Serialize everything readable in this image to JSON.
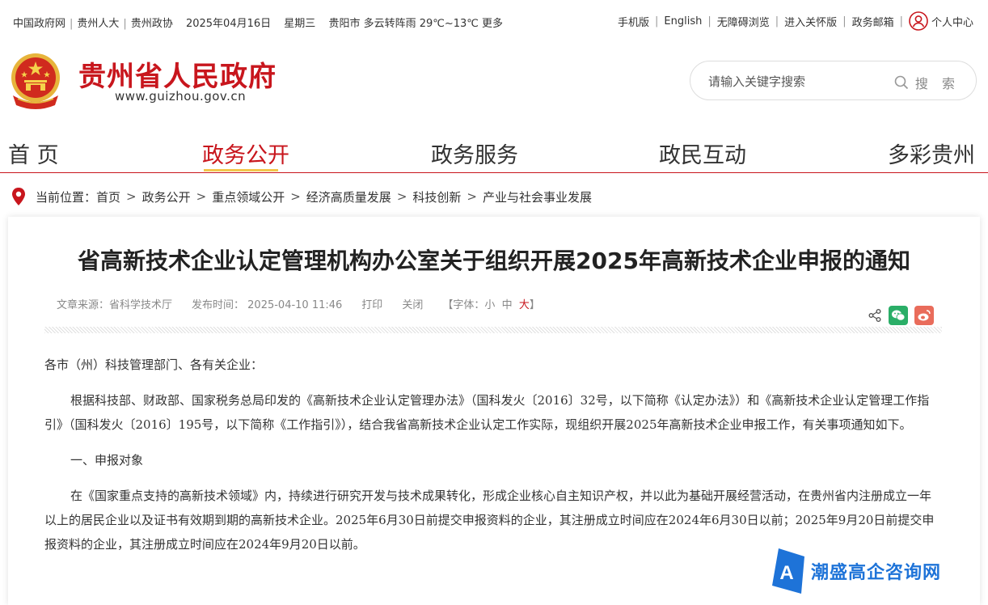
{
  "topbar": {
    "left_links": [
      "中国政府网",
      "贵州人大",
      "贵州政协"
    ],
    "date": "2025年04月16日",
    "weekday": "星期三",
    "weather": "贵阳市 多云转阵雨 29℃~13℃",
    "more": "更多",
    "right_links": [
      "手机版",
      "English",
      "无障碍浏览",
      "进入关怀版",
      "政务邮箱"
    ],
    "user_center": "个人中心"
  },
  "header": {
    "site_title": "贵州省人民政府",
    "site_url": "www.guizhou.gov.cn",
    "search_placeholder": "请输入关键字搜索",
    "search_button": "搜 索"
  },
  "nav": {
    "items": [
      "首 页",
      "政务公开",
      "政务服务",
      "政民互动",
      "多彩贵州"
    ],
    "active": "政务公开"
  },
  "breadcrumb": {
    "label": "当前位置：",
    "items": [
      "首页",
      "政务公开",
      "重点领域公开",
      "经济高质量发展",
      "科技创新",
      "产业与社会事业发展"
    ]
  },
  "article": {
    "title": "省高新技术企业认定管理机构办公室关于组织开展2025年高新技术企业申报的通知",
    "source": "文章来源：省科学技术厅",
    "publish_time": "发布时间：  2025-04-10 11:46",
    "print": "打印",
    "close": "关闭",
    "font_size_label": "【字体：",
    "font_small": "小",
    "font_medium": "中",
    "font_large": "大",
    "font_close": "】",
    "paragraphs": [
      "各市（州）科技管理部门、各有关企业：",
      "根据科技部、财政部、国家税务总局印发的《高新技术企业认定管理办法》（国科发火〔2016〕32号，以下简称《认定办法》）和《高新技术企业认定管理工作指引》（国科发火〔2016〕195号，以下简称《工作指引》），结合我省高新技术企业认定工作实际，现组织开展2025年高新技术企业申报工作，有关事项通知如下。",
      "一、申报对象",
      "在《国家重点支持的高新技术领域》内，持续进行研究开发与技术成果转化，形成企业核心自主知识产权，并以此为基础开展经营活动，在贵州省内注册成立一年以上的居民企业以及证书有效期到期的高新技术企业。2025年6月30日前提交申报资料的企业，其注册成立时间应在2024年6月30日以前；2025年9月20日前提交申报资料的企业，其注册成立时间应在2024年9月20日以前。"
    ]
  },
  "watermark": {
    "text": "潮盛高企咨询网"
  },
  "colors": {
    "brand_red": "#c8161d",
    "nav_underline": "#f3c64b",
    "wechat": "#2aae67",
    "weibo": "#e96c5b",
    "watermark_blue": "#1e73d8"
  }
}
